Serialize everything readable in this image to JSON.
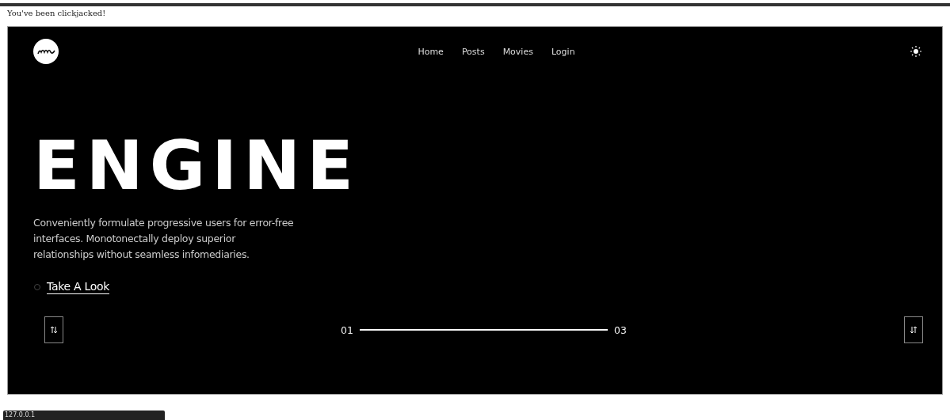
{
  "page": {
    "message": "You've been clickjacked!"
  },
  "nav": {
    "links": [
      {
        "label": "Home"
      },
      {
        "label": "Posts"
      },
      {
        "label": "Movies"
      },
      {
        "label": "Login"
      }
    ]
  },
  "hero": {
    "title": "ENGINE",
    "description": "Conveniently formulate progressive users for error-free interfaces. Monotonectally deploy superior relationships without seamless infomediaries.",
    "cta": "Take A Look"
  },
  "slider": {
    "current": "01",
    "total": "03",
    "level": 1
  },
  "status_bar": {
    "url": "127.0.0.1"
  }
}
